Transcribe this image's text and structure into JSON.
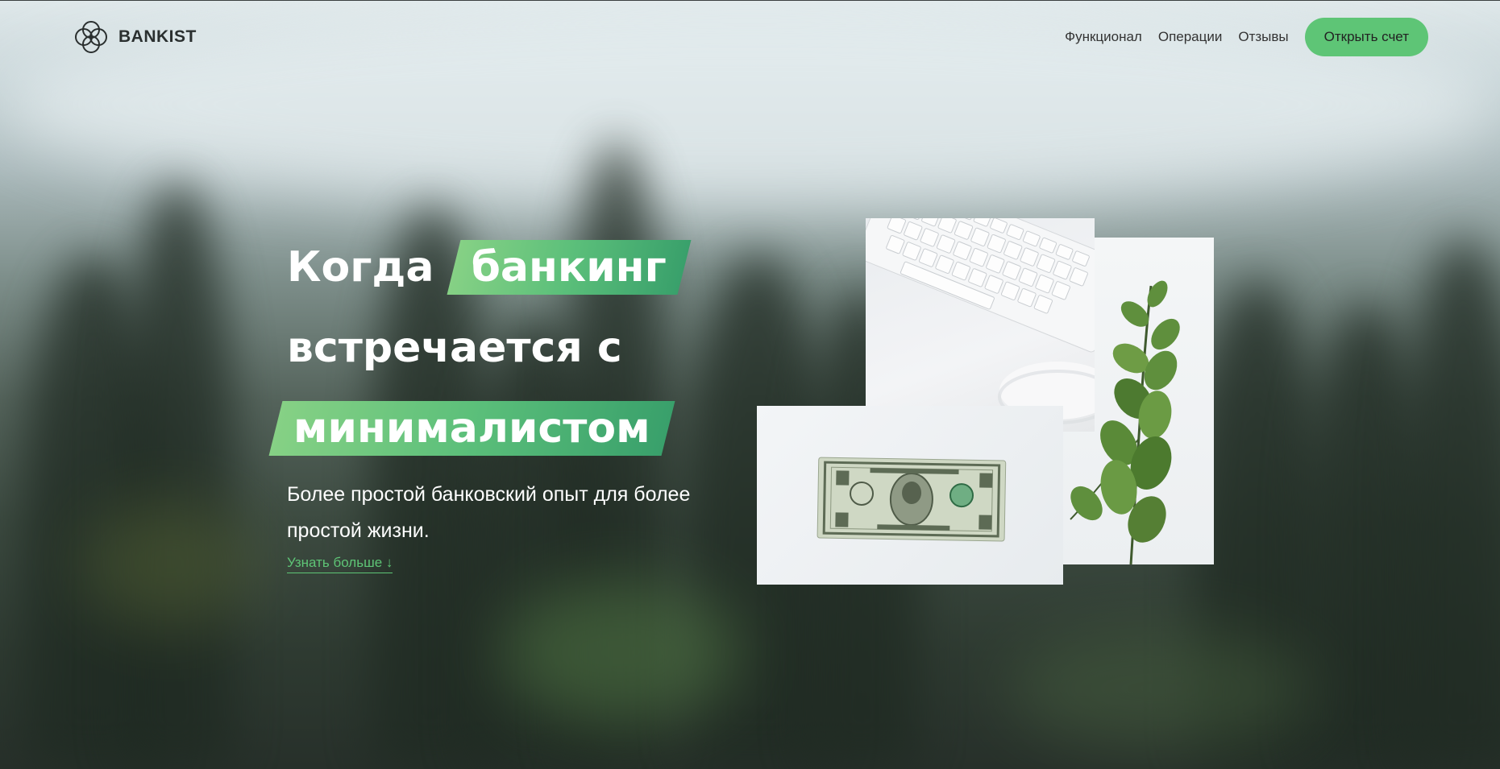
{
  "header": {
    "brand": "BANKIST",
    "nav": [
      "Функционал",
      "Операции",
      "Отзывы"
    ],
    "cta_label": "Открыть счет"
  },
  "hero": {
    "title_word_1": "Когда",
    "title_highlight_1": "банкинг",
    "title_line_2": "встречается с",
    "title_highlight_2": "минималистом",
    "subtitle": "Более простой банковский опыт для более простой жизни.",
    "learn_more": "Узнать больше ↓"
  },
  "images": [
    {
      "name": "keyboard-mouse-photo"
    },
    {
      "name": "plant-photo"
    },
    {
      "name": "dollar-bill-photo"
    }
  ],
  "colors": {
    "accent": "#5ec576",
    "highlight_start": "#86d185",
    "highlight_end": "#39a06b"
  }
}
